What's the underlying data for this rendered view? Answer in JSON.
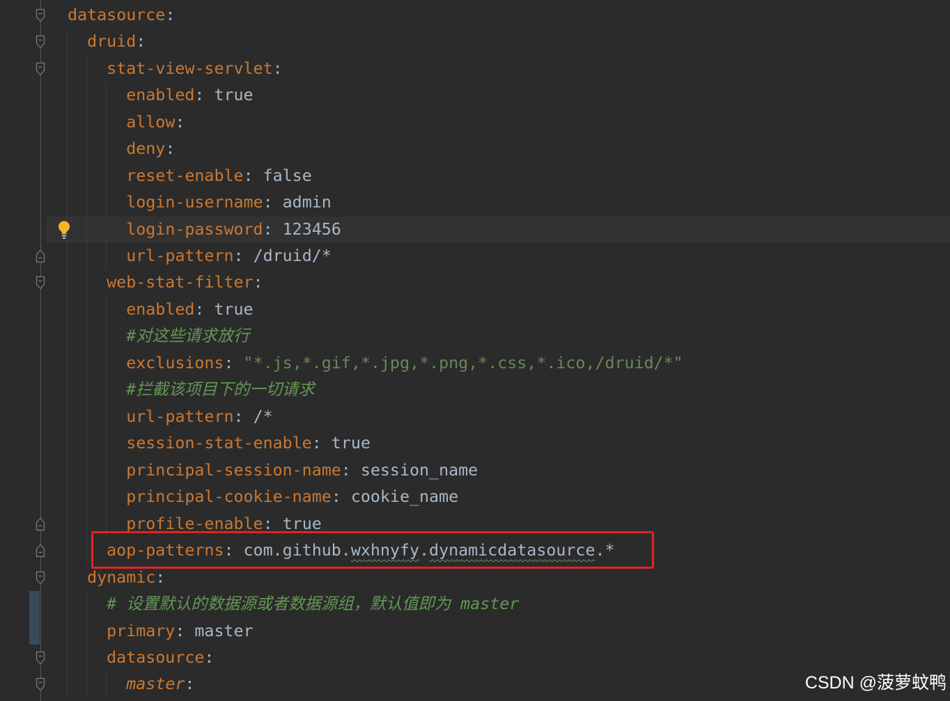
{
  "colors": {
    "background": "#2b2b2b",
    "current_line": "#323232",
    "key": "#cc7832",
    "value": "#a9b7c6",
    "string": "#6a8759",
    "comment": "#629755",
    "typo_underline": "#629755",
    "gutter_icon": "#7a7e85",
    "fold_line": "#555555",
    "indent_guide": "#3b3b3b",
    "change_marker": "#3a4a5a",
    "annotation": "#e62222",
    "lightbulb": "#f4b52a",
    "lightbulb_base": "#b8bcc2",
    "watermark": "#ffffff"
  },
  "editor": {
    "lines": [
      {
        "indent": "  ",
        "tokens": [
          [
            "key",
            "datasource"
          ],
          [
            "colon",
            ":"
          ]
        ],
        "gutter_icon": "fold-start-icon"
      },
      {
        "indent": "    ",
        "tokens": [
          [
            "key",
            "druid"
          ],
          [
            "colon",
            ":"
          ]
        ],
        "gutter_icon": "fold-start-icon"
      },
      {
        "indent": "      ",
        "tokens": [
          [
            "key",
            "stat-view-servlet"
          ],
          [
            "colon",
            ":"
          ]
        ],
        "gutter_icon": "fold-start-icon"
      },
      {
        "indent": "        ",
        "tokens": [
          [
            "key",
            "enabled"
          ],
          [
            "colon",
            ": "
          ],
          [
            "value",
            "true"
          ]
        ]
      },
      {
        "indent": "        ",
        "tokens": [
          [
            "key",
            "allow"
          ],
          [
            "colon",
            ":"
          ]
        ]
      },
      {
        "indent": "        ",
        "tokens": [
          [
            "key",
            "deny"
          ],
          [
            "colon",
            ":"
          ]
        ]
      },
      {
        "indent": "        ",
        "tokens": [
          [
            "key",
            "reset-enable"
          ],
          [
            "colon",
            ": "
          ],
          [
            "value",
            "false"
          ]
        ]
      },
      {
        "indent": "        ",
        "tokens": [
          [
            "key",
            "login-username"
          ],
          [
            "colon",
            ": "
          ],
          [
            "value",
            "admin"
          ]
        ]
      },
      {
        "indent": "        ",
        "tokens": [
          [
            "key",
            "login-password"
          ],
          [
            "colon",
            ": "
          ],
          [
            "value",
            "123456"
          ]
        ],
        "current": true,
        "intention_icon": "lightbulb-icon"
      },
      {
        "indent": "        ",
        "tokens": [
          [
            "key",
            "url-pattern"
          ],
          [
            "colon",
            ": "
          ],
          [
            "value",
            "/druid/*"
          ]
        ],
        "gutter_icon": "fold-end-icon"
      },
      {
        "indent": "      ",
        "tokens": [
          [
            "key",
            "web-stat-filter"
          ],
          [
            "colon",
            ":"
          ]
        ],
        "gutter_icon": "fold-start-icon"
      },
      {
        "indent": "        ",
        "tokens": [
          [
            "key",
            "enabled"
          ],
          [
            "colon",
            ": "
          ],
          [
            "value",
            "true"
          ]
        ]
      },
      {
        "indent": "        ",
        "tokens": [
          [
            "comment",
            "#对这些请求放行"
          ]
        ]
      },
      {
        "indent": "        ",
        "tokens": [
          [
            "key",
            "exclusions"
          ],
          [
            "colon",
            ": "
          ],
          [
            "string",
            "\"*.js,*.gif,*.jpg,*.png,*.css,*.ico,/druid/*\""
          ]
        ]
      },
      {
        "indent": "        ",
        "tokens": [
          [
            "comment",
            "#拦截该项目下的一切请求"
          ]
        ]
      },
      {
        "indent": "        ",
        "tokens": [
          [
            "key",
            "url-pattern"
          ],
          [
            "colon",
            ": "
          ],
          [
            "value",
            "/*"
          ]
        ]
      },
      {
        "indent": "        ",
        "tokens": [
          [
            "key",
            "session-stat-enable"
          ],
          [
            "colon",
            ": "
          ],
          [
            "value",
            "true"
          ]
        ]
      },
      {
        "indent": "        ",
        "tokens": [
          [
            "key",
            "principal-session-name"
          ],
          [
            "colon",
            ": "
          ],
          [
            "value",
            "session_name"
          ]
        ]
      },
      {
        "indent": "        ",
        "tokens": [
          [
            "key",
            "principal-cookie-name"
          ],
          [
            "colon",
            ": "
          ],
          [
            "value",
            "cookie_name"
          ]
        ]
      },
      {
        "indent": "        ",
        "tokens": [
          [
            "key",
            "profile-enable"
          ],
          [
            "colon",
            ": "
          ],
          [
            "value",
            "true"
          ]
        ],
        "gutter_icon": "fold-end-icon"
      },
      {
        "indent": "      ",
        "tokens": [
          [
            "key",
            "aop-patterns"
          ],
          [
            "colon",
            ": "
          ],
          [
            "value",
            "com.github."
          ],
          [
            "typo",
            "wxhnyfy"
          ],
          [
            "value",
            "."
          ],
          [
            "typo",
            "dynamicdatasource"
          ],
          [
            "value",
            ".*"
          ]
        ],
        "gutter_icon": "fold-end-icon",
        "annotated": true
      },
      {
        "indent": "    ",
        "tokens": [
          [
            "key",
            "dynamic"
          ],
          [
            "colon",
            ":"
          ]
        ],
        "gutter_icon": "fold-start-icon"
      },
      {
        "indent": "      ",
        "tokens": [
          [
            "comment",
            "# 设置默认的数据源或者数据源组，默认值即为 master"
          ]
        ],
        "vcs_change": "modified"
      },
      {
        "indent": "      ",
        "tokens": [
          [
            "key",
            "primary"
          ],
          [
            "colon",
            ": "
          ],
          [
            "value",
            "master"
          ]
        ],
        "vcs_change": "modified"
      },
      {
        "indent": "      ",
        "tokens": [
          [
            "key",
            "datasource"
          ],
          [
            "colon",
            ":"
          ]
        ],
        "gutter_icon": "fold-start-icon"
      },
      {
        "indent": "        ",
        "tokens": [
          [
            "key_italic",
            "master"
          ],
          [
            "colon",
            ":"
          ]
        ],
        "gutter_icon": "fold-start-icon"
      }
    ]
  },
  "watermark": "CSDN @菠萝蚊鸭"
}
